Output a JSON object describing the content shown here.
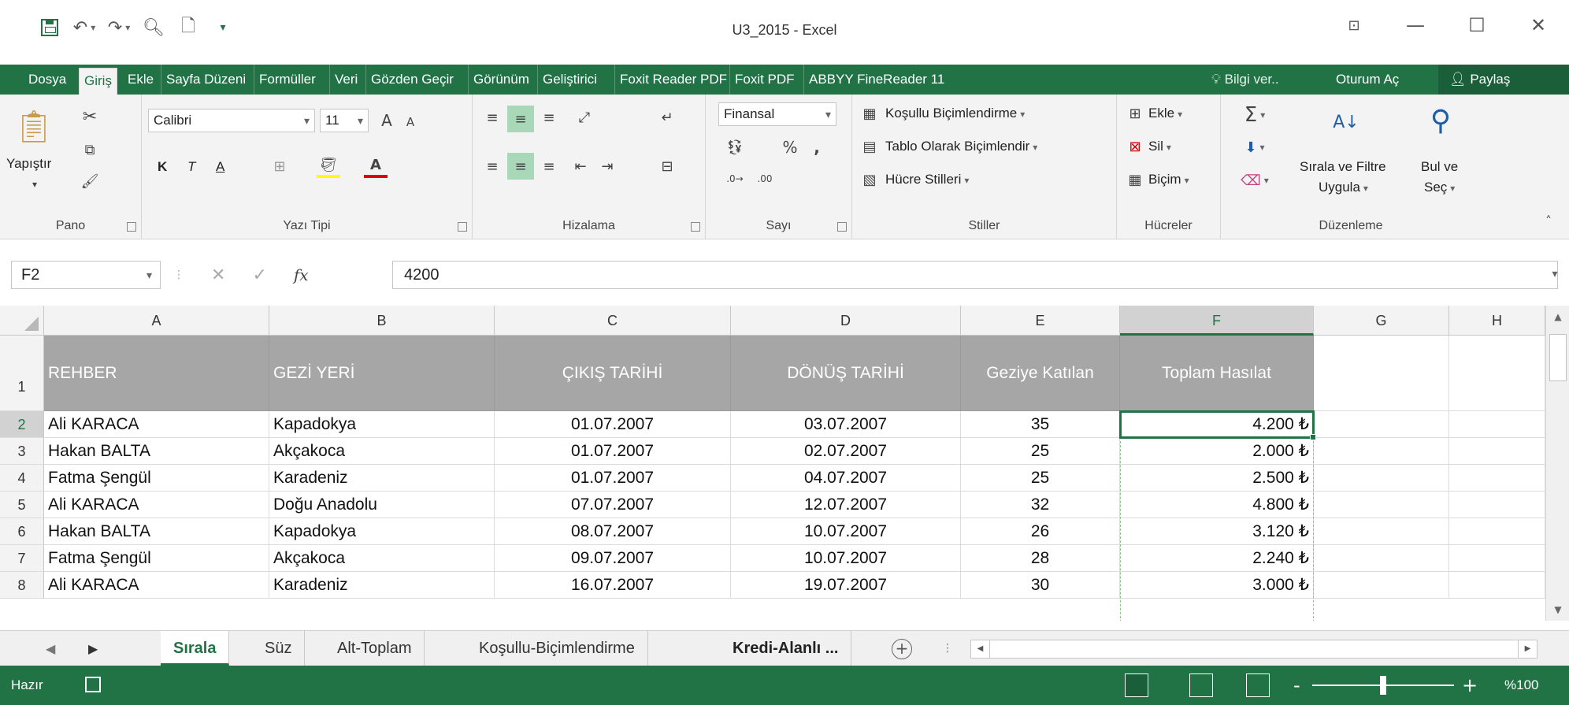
{
  "window": {
    "title": "U3_2015 - Excel"
  },
  "ribbon_tabs": [
    {
      "label": "Dosya"
    },
    {
      "label": "Giriş"
    },
    {
      "label": "Ekle"
    },
    {
      "label": "Sayfa Düzeni"
    },
    {
      "label": "Formüller"
    },
    {
      "label": "Veri"
    },
    {
      "label": "Gözden Geçir"
    },
    {
      "label": "Görünüm"
    },
    {
      "label": "Geliştirici"
    },
    {
      "label": "Foxit Reader PDF"
    },
    {
      "label": "Foxit PDF"
    },
    {
      "label": "ABBYY FineReader 11"
    }
  ],
  "tell_me": "Bilgi ver..",
  "sign_in": "Oturum Aç",
  "share": "Paylaş",
  "ribbon": {
    "clipboard": {
      "paste": "Yapıştır",
      "label": "Pano"
    },
    "font": {
      "name": "Calibri",
      "size": "11",
      "bold": "K",
      "italic": "T",
      "underline": "A",
      "label": "Yazı Tipi"
    },
    "alignment": {
      "label": "Hizalama"
    },
    "number": {
      "format": "Finansal",
      "label": "Sayı"
    },
    "styles": {
      "conditional": "Koşullu Biçimlendirme",
      "table": "Tablo Olarak Biçimlendir",
      "cell": "Hücre Stilleri",
      "label": "Stiller"
    },
    "cells": {
      "insert": "Ekle",
      "delete": "Sil",
      "format": "Biçim",
      "label": "Hücreler"
    },
    "editing": {
      "sort1": "Sırala ve Filtre",
      "sort2": "Uygula",
      "find1": "Bul ve",
      "find2": "Seç",
      "label": "Düzenleme"
    }
  },
  "formula_bar": {
    "name_box": "F2",
    "formula": "4200",
    "fx": "fx"
  },
  "columns": [
    "A",
    "B",
    "C",
    "D",
    "E",
    "F",
    "G",
    "H"
  ],
  "table": {
    "headers": [
      "REHBER",
      "GEZİ YERİ",
      "ÇIKIŞ TARİHİ",
      "DÖNÜŞ TARİHİ",
      "Geziye Katılan",
      "Toplam Hasılat"
    ],
    "rows": [
      {
        "num": "2",
        "cells": [
          "Ali KARACA",
          "Kapadokya",
          "01.07.2007",
          "03.07.2007",
          "35",
          "4.200 ₺"
        ]
      },
      {
        "num": "3",
        "cells": [
          "Hakan BALTA",
          "Akçakoca",
          "01.07.2007",
          "02.07.2007",
          "25",
          "2.000 ₺"
        ]
      },
      {
        "num": "4",
        "cells": [
          "Fatma Şengül",
          "Karadeniz",
          "01.07.2007",
          "04.07.2007",
          "25",
          "2.500 ₺"
        ]
      },
      {
        "num": "5",
        "cells": [
          "Ali KARACA",
          "Doğu Anadolu",
          "07.07.2007",
          "12.07.2007",
          "32",
          "4.800 ₺"
        ]
      },
      {
        "num": "6",
        "cells": [
          "Hakan BALTA",
          "Kapadokya",
          "08.07.2007",
          "10.07.2007",
          "26",
          "3.120 ₺"
        ]
      },
      {
        "num": "7",
        "cells": [
          "Fatma Şengül",
          "Akçakoca",
          "09.07.2007",
          "10.07.2007",
          "28",
          "2.240 ₺"
        ]
      },
      {
        "num": "8",
        "cells": [
          "Ali KARACA",
          "Karadeniz",
          "16.07.2007",
          "19.07.2007",
          "30",
          "3.000 ₺"
        ]
      }
    ]
  },
  "header_row_num": "1",
  "sheets": [
    {
      "label": "Sırala"
    },
    {
      "label": "Süz"
    },
    {
      "label": "Alt-Toplam"
    },
    {
      "label": "Koşullu-Biçimlendirme"
    },
    {
      "label": "Kredi-Alanlı ..."
    }
  ],
  "status": {
    "ready": "Hazır",
    "zoom": "%100"
  },
  "colors": {
    "accent": "#217346",
    "header_fill": "#a6a6a6"
  }
}
